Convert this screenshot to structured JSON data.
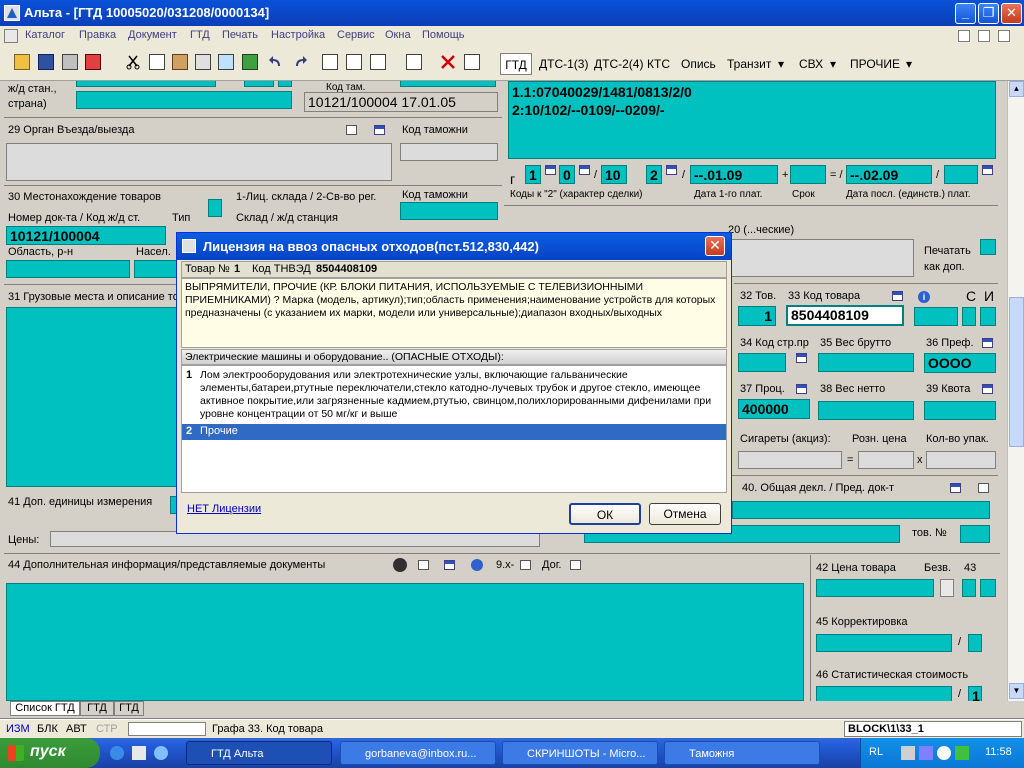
{
  "window": {
    "title": "Альта - [ГТД 10005020/031208/0000134]",
    "buttons": {
      "minimize": "_",
      "restore": "❐",
      "close": "✕"
    }
  },
  "menu": [
    "Каталог",
    "Правка",
    "Документ",
    "ГТД",
    "Печать",
    "Настройка",
    "Сервис",
    "Окна",
    "Помощь"
  ],
  "tabs": {
    "gtd": "ГТД",
    "dts1": "ДТС-1(3)",
    "dts2": "ДТС-2(4)",
    "kts": "КТС",
    "opis": "Опись",
    "tranzit": "Транзит",
    "svh": "СВХ",
    "prochie": "ПРОЧИЕ"
  },
  "form": {
    "zhd_label": "ж/д стан.,",
    "strana_label": "страна)",
    "kod_tam_label": "Код там.",
    "kod_tam_value": "10121/100004 17.01.05",
    "f29_label": "29 Орган Въезда/выезда",
    "kod_tamozhni": "Код таможни",
    "f30_label": "30 Местонахождение товаров",
    "lic_label": "1-Лиц. склада / 2-Св-во рег.",
    "kod_tamozhni2": "Код таможни",
    "nomer_label": "Номер док-та / Код ж/д ст.",
    "tip_label": "Тип",
    "sklad_label": "Склад / ж/д станция",
    "nomer_value": "10121/100004",
    "oblast_label": "Область, р-н",
    "nasel_label": "Насел.",
    "f31_label": "31 Грузовые места и описание то",
    "dog_line1": "1.1:07040029/1481/0813/2/0",
    "dog_line2": "2:10/102/--0109/--0209/-",
    "codes": {
      "c1": "1",
      "c2": "0",
      "c3": "10",
      "c4": "2"
    },
    "date1": "--.01.09",
    "date2": "--.02.09",
    "codes_caption": "Коды к \"2\" (характер сделки)",
    "date1_caption": "Дата 1-го плат.",
    "srok_caption": "Срок",
    "datep_caption": "Дата посл. (единств.) плат.",
    "f20_partial": "20 (...ческие)",
    "pechatat": "Печатать",
    "kak_dop": "как доп.",
    "f32_label": "32 Тов.",
    "f32_value": "1",
    "f33_label": "33 Код товара",
    "f33_value": "8504408109",
    "c_label": "С",
    "i_label": "И",
    "f34_label": "34 Код стр.пр",
    "f35_label": "35 Вес брутто",
    "f36_label": "36 Преф.",
    "f36_value": "ОООО",
    "f37_label": "37 Проц.",
    "f37_value": "400000",
    "f38_label": "38 Вес нетто",
    "f39_label": "39 Квота",
    "sigarety": "Сигареты (акциз):",
    "rozn": "Розн. цена",
    "kol_upak": "Кол-во упак.",
    "eq": "=",
    "x": "x",
    "f40_label": "40. Общая декл. / Пред. док-т",
    "f41_label": "41 Доп. единицы измерения",
    "tov_no": "тов. №",
    "ceny": "Цены:",
    "f44_label": "44 Дополнительная информация/представляемые документы",
    "btn_9x": "9.х-",
    "dog": "Дог.",
    "f42_label": "42 Цена товара",
    "bezv": "Безв.",
    "f43_label": "43",
    "f45_label": "45 Корректировка",
    "f46_label": "46 Статистическая стоимость",
    "f46_value": "1"
  },
  "dialog": {
    "title": "Лицензия на ввоз опасных отходов(пст.512,830,442)",
    "tovar_label": "Товар №",
    "tovar_value": "1",
    "tnved_label": "Код ТНВЭД",
    "tnved_value": "8504408109",
    "description": "ВЫПРЯМИТЕЛИ, ПРОЧИЕ (КР. БЛОКИ ПИТАНИЯ, ИСПОЛЬЗУЕМЫЕ С ТЕЛЕВИЗИОННЫМИ ПРИЕМНИКАМИ) ? Марка (модель, артикул);тип;область применения;наименование устройств для которых предназначены (с указанием их марки, модели или универсальные);диапазон входных/выходных",
    "category": "Электрические машины и оборудование.. (ОПАСНЫЕ ОТХОДЫ):",
    "items": [
      {
        "num": "1",
        "text": "Лом электрооборудования или электротехнические узлы, включающие гальванические элементы,батареи,ртутные переключатели,стекло катодно-лучевых трубок и другое стекло, имеющее активное покрытие,или загрязненные кадмием,ртутью, свинцом,полихлорированными дифенилами при уровне концентрации от 50 мг/кг и выше"
      },
      {
        "num": "2",
        "text": "Прочие"
      }
    ],
    "no_license_link": "НЕТ Лицензии",
    "ok": "ОК",
    "cancel": "Отмена"
  },
  "bottom_tabs": [
    "Список ГТД",
    "ГТД",
    "ГТД"
  ],
  "status": {
    "izm": "ИЗМ",
    "blk": "БЛК",
    "avt": "АВТ",
    "str": "СТР",
    "grafa": "Графа 33. Код товара",
    "block": "BLOCK\\1\\33_1"
  },
  "taskbar": {
    "start": "пуск",
    "tasks": [
      "ГТД Альта",
      "gorbaneva@inbox.ru...",
      "СКРИНШОТЫ - Micro...",
      "Таможня"
    ],
    "lang": "RL",
    "time": "11:58"
  },
  "colors": {
    "field": "#00c0c0",
    "window_bg": "#d4d0c8",
    "titlebar": "#0a52d8",
    "selection": "#316ac5"
  }
}
